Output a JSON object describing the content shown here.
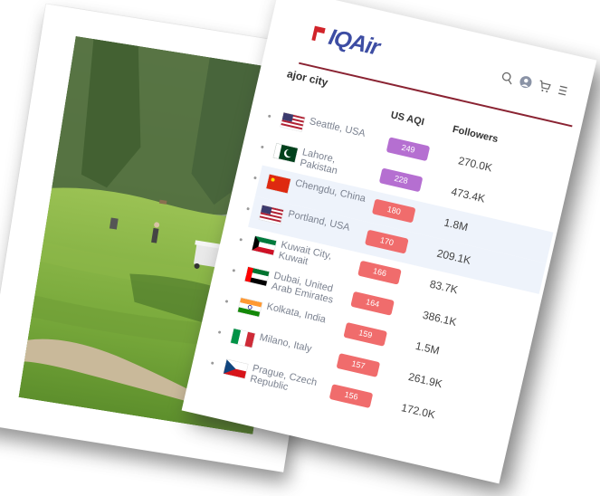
{
  "header": {
    "logo_text": "IQAir",
    "icons": [
      "search-icon",
      "user-icon",
      "cart-icon",
      "menu-icon"
    ]
  },
  "table": {
    "title": "ajor city",
    "columns": [
      "US AQI",
      "Followers"
    ],
    "rows": [
      {
        "city": "Seattle, USA",
        "aqi": "249",
        "followers": "270.0K",
        "flag": "usa",
        "badge_color": "#b56fd1"
      },
      {
        "city": "Lahore, Pakistan",
        "aqi": "228",
        "followers": "473.4K",
        "flag": "pakistan",
        "badge_color": "#b56fd1"
      },
      {
        "city": "Chengdu, China",
        "aqi": "180",
        "followers": "1.8M",
        "flag": "china",
        "badge_color": "#f06c6c"
      },
      {
        "city": "Portland, USA",
        "aqi": "170",
        "followers": "209.1K",
        "flag": "usa",
        "badge_color": "#f06c6c"
      },
      {
        "city": "Kuwait City, Kuwait",
        "aqi": "166",
        "followers": "83.7K",
        "flag": "kuwait",
        "badge_color": "#f06c6c"
      },
      {
        "city": "Dubai, United Arab Emirates",
        "aqi": "164",
        "followers": "386.1K",
        "flag": "uae",
        "badge_color": "#f06c6c"
      },
      {
        "city": "Kolkata, India",
        "aqi": "159",
        "followers": "1.5M",
        "flag": "india",
        "badge_color": "#f06c6c"
      },
      {
        "city": "Milano, Italy",
        "aqi": "157",
        "followers": "261.9K",
        "flag": "italy",
        "badge_color": "#f06c6c"
      },
      {
        "city": "Prague, Czech Republic",
        "aqi": "156",
        "followers": "172.0K",
        "flag": "czech",
        "badge_color": "#f06c6c"
      }
    ]
  },
  "colors": {
    "brand_blue": "#3d4da3",
    "brand_red": "#d1232a",
    "header_rule": "#8a2332",
    "purple_badge": "#b56fd1",
    "red_badge": "#f06c6c"
  }
}
